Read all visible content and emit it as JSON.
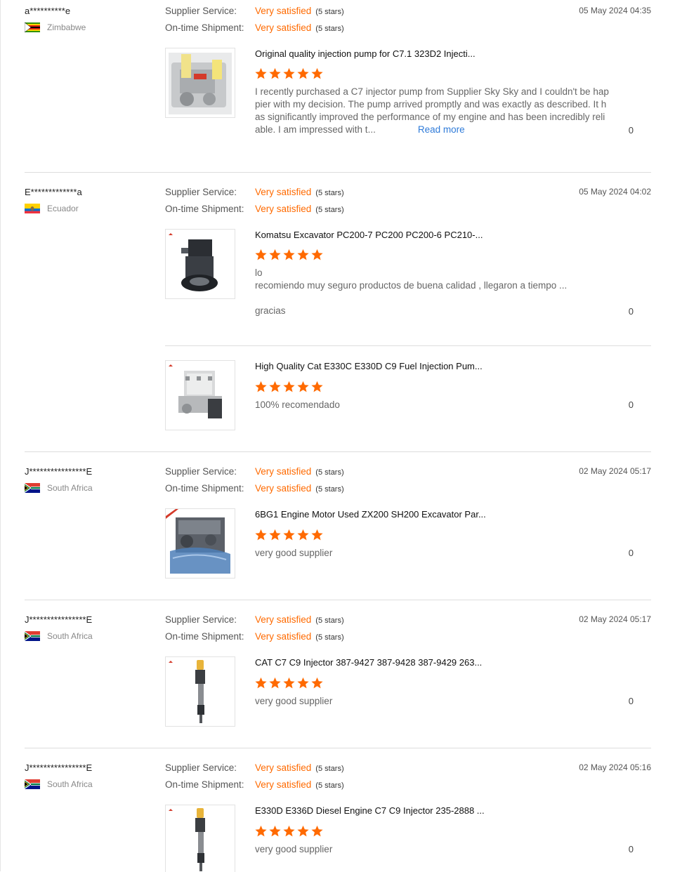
{
  "labels": {
    "supplier_service": "Supplier Service:",
    "ontime_shipment": "On-time Shipment:",
    "read_more": "Read more"
  },
  "colors": {
    "accent": "#ff6a00",
    "link": "#2f7bd9"
  },
  "reviews": [
    {
      "buyer": "a**********e",
      "country": "Zimbabwe",
      "flag": "zimbabwe-flag-icon",
      "date": "05 May 2024 04:35",
      "supplier_service": {
        "value": "Very satisfied",
        "stars": "(5 stars)"
      },
      "ontime_shipment": {
        "value": "Very satisfied",
        "stars": "(5 stars)"
      },
      "products": [
        {
          "title": "Original quality injection pump for C7.1 323D2 Injecti...",
          "rating": 5,
          "text_lines": [
            "I recently purchased a C7 injector pump from Supplier Sky Sky and I couldn't be hap",
            "pier with my decision. The pump arrived promptly and was exactly as described. It h",
            "as significantly improved the performance of my engine and has been incredibly reli",
            "able. I am impressed with t..."
          ],
          "likes": "0"
        }
      ]
    },
    {
      "buyer": "E*************a",
      "country": "Ecuador",
      "flag": "ecuador-flag-icon",
      "date": "05 May 2024 04:02",
      "supplier_service": {
        "value": "Very satisfied",
        "stars": "(5 stars)"
      },
      "ontime_shipment": {
        "value": "Very satisfied",
        "stars": "(5 stars)"
      },
      "products": [
        {
          "title": "Komatsu Excavator PC200-7 PC200 PC200-6 PC210-...",
          "rating": 5,
          "text_lines": [
            "lo",
            "recomiendo muy seguro productos de buena calidad , llegaron a tiempo ...",
            "",
            "gracias"
          ],
          "likes": "0"
        },
        {
          "title": "High Quality Cat E330C E330D C9 Fuel Injection Pum...",
          "rating": 5,
          "text_lines": [
            "100% recomendado"
          ],
          "likes": "0"
        }
      ]
    },
    {
      "buyer": "J****************E",
      "country": "South Africa",
      "flag": "south-africa-flag-icon",
      "date": "02 May 2024 05:17",
      "supplier_service": {
        "value": "Very satisfied",
        "stars": "(5 stars)"
      },
      "ontime_shipment": {
        "value": "Very satisfied",
        "stars": "(5 stars)"
      },
      "products": [
        {
          "title": "6BG1 Engine Motor Used ZX200 SH200 Excavator Par...",
          "rating": 5,
          "text_lines": [
            "very good supplier"
          ],
          "likes": "0"
        }
      ]
    },
    {
      "buyer": "J****************E",
      "country": "South Africa",
      "flag": "south-africa-flag-icon",
      "date": "02 May 2024 05:17",
      "supplier_service": {
        "value": "Very satisfied",
        "stars": "(5 stars)"
      },
      "ontime_shipment": {
        "value": "Very satisfied",
        "stars": "(5 stars)"
      },
      "products": [
        {
          "title": "CAT C7 C9 Injector 387-9427 387-9428 387-9429 263...",
          "rating": 5,
          "text_lines": [
            "very good supplier"
          ],
          "likes": "0"
        }
      ]
    },
    {
      "buyer": "J****************E",
      "country": "South Africa",
      "flag": "south-africa-flag-icon",
      "date": "02 May 2024 05:16",
      "supplier_service": {
        "value": "Very satisfied",
        "stars": "(5 stars)"
      },
      "ontime_shipment": {
        "value": "Very satisfied",
        "stars": "(5 stars)"
      },
      "products": [
        {
          "title": "E330D E336D Diesel Engine C7 C9 Injector 235-2888 ...",
          "rating": 5,
          "text_lines": [
            "very good supplier"
          ],
          "likes": "0"
        }
      ]
    }
  ]
}
